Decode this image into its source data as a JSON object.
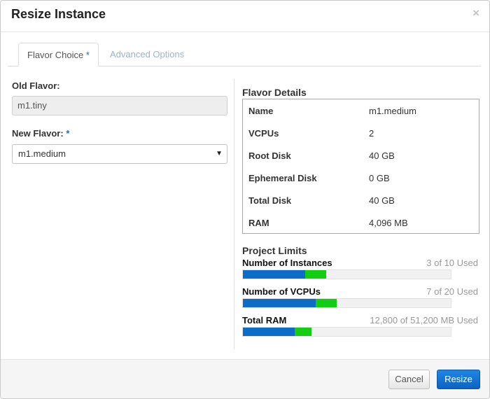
{
  "dialog": {
    "title": "Resize Instance",
    "close_symbol": "×"
  },
  "tabs": [
    {
      "label": "Flavor Choice",
      "required_marker": "*",
      "active": true
    },
    {
      "label": "Advanced Options",
      "active": false
    }
  ],
  "form": {
    "old_flavor": {
      "label": "Old Flavor:",
      "value": "m1.tiny"
    },
    "new_flavor": {
      "label": "New Flavor:",
      "required_marker": "*",
      "selected": "m1.medium",
      "arrow": "▼"
    }
  },
  "flavor_details": {
    "heading": "Flavor Details",
    "rows": [
      {
        "key": "Name",
        "value": "m1.medium"
      },
      {
        "key": "VCPUs",
        "value": "2"
      },
      {
        "key": "Root Disk",
        "value": "40 GB"
      },
      {
        "key": "Ephemeral Disk",
        "value": "0 GB"
      },
      {
        "key": "Total Disk",
        "value": "40 GB"
      },
      {
        "key": "RAM",
        "value": "4,096 MB"
      }
    ]
  },
  "project_limits": {
    "heading": "Project Limits",
    "items": [
      {
        "label": "Number of Instances",
        "used_text": "3 of 10 Used",
        "used_fraction": 0.3,
        "added_fraction": 0.1
      },
      {
        "label": "Number of VCPUs",
        "used_text": "7 of 20 Used",
        "used_fraction": 0.35,
        "added_fraction": 0.1
      },
      {
        "label": "Total RAM",
        "used_text": "12,800 of 51,200 MB Used",
        "used_fraction": 0.25,
        "added_fraction": 0.08
      }
    ]
  },
  "colors": {
    "used_bar": "#0d6cc7",
    "added_bar": "#12cd12",
    "primary_button": "#0c63c0"
  },
  "footer": {
    "cancel_label": "Cancel",
    "submit_label": "Resize"
  }
}
